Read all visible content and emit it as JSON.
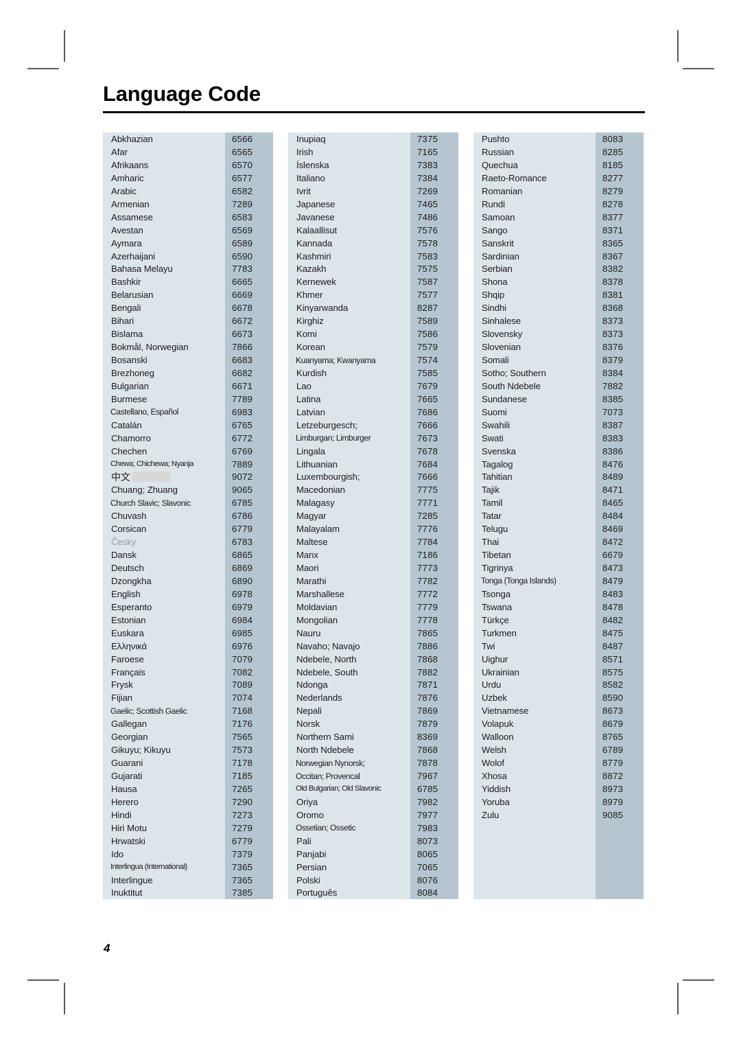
{
  "page": {
    "title": "Language Code",
    "page_number": "4"
  },
  "colors": {
    "name_cell_bg": "#dce5ea",
    "code_cell_bg": "#b5c6d0",
    "text": "#1a1a1a",
    "rule": "#000000",
    "redaction": "#d8d8d8",
    "crop_mark": "#5a5a5a"
  },
  "columns": [
    {
      "id": "column-1",
      "rows": [
        {
          "name": "Abkhazian",
          "code": "6566"
        },
        {
          "name": "Afar",
          "code": "6565"
        },
        {
          "name": "Afrikaans",
          "code": "6570"
        },
        {
          "name": "Amharic",
          "code": "6577"
        },
        {
          "name": "Arabic",
          "code": "6582"
        },
        {
          "name": "Armenian",
          "code": "7289"
        },
        {
          "name": "Assamese",
          "code": "6583"
        },
        {
          "name": "Avestan",
          "code": "6569"
        },
        {
          "name": "Aymara",
          "code": "6589"
        },
        {
          "name": "Azerhaijani",
          "code": "6590"
        },
        {
          "name": "Bahasa Melayu",
          "code": "7783"
        },
        {
          "name": "Bashkir",
          "code": "6665"
        },
        {
          "name": "Belarusian",
          "code": "6669"
        },
        {
          "name": "Bengali",
          "code": "6678"
        },
        {
          "name": "Bihari",
          "code": "6672"
        },
        {
          "name": "Bislama",
          "code": "6673"
        },
        {
          "name": "Bokmål, Norwegian",
          "code": "7866"
        },
        {
          "name": "Bosanski",
          "code": "6683"
        },
        {
          "name": "Brezhoneg",
          "code": "6682"
        },
        {
          "name": "Bulgarian",
          "code": "6671"
        },
        {
          "name": "Burmese",
          "code": "7789"
        },
        {
          "name": "Castellano, Español",
          "code": "6983",
          "style": "condensed"
        },
        {
          "name": "Catalán",
          "code": "6765"
        },
        {
          "name": "Chamorro",
          "code": "6772"
        },
        {
          "name": "Chechen",
          "code": "6769"
        },
        {
          "name": "Chewa; Chichewa; Nyanja",
          "code": "7889",
          "style": "very-condensed"
        },
        {
          "name": "中文",
          "code": "9072",
          "style": "cjk-redacted"
        },
        {
          "name": "Chuang; Zhuang",
          "code": "9065"
        },
        {
          "name": "Church Slavic; Slavonic",
          "code": "6785",
          "style": "condensed"
        },
        {
          "name": "Chuvash",
          "code": "6786"
        },
        {
          "name": "Corsican",
          "code": "6779"
        },
        {
          "name": "Česky",
          "code": "6783",
          "style": "faded"
        },
        {
          "name": "Dansk",
          "code": "6865"
        },
        {
          "name": "Deutsch",
          "code": "6869"
        },
        {
          "name": "Dzongkha",
          "code": "6890"
        },
        {
          "name": "English",
          "code": "6978"
        },
        {
          "name": "Esperanto",
          "code": "6979"
        },
        {
          "name": "Estonian",
          "code": "6984"
        },
        {
          "name": "Euskara",
          "code": "6985"
        },
        {
          "name": "Ελληνικά",
          "code": "6976"
        },
        {
          "name": "Faroese",
          "code": "7079"
        },
        {
          "name": "Français",
          "code": "7082"
        },
        {
          "name": "Frysk",
          "code": "7089"
        },
        {
          "name": "Fijian",
          "code": "7074"
        },
        {
          "name": "Gaelic; Scottish Gaelic",
          "code": "7168",
          "style": "condensed"
        },
        {
          "name": "Gallegan",
          "code": "7176"
        },
        {
          "name": "Georgian",
          "code": "7565"
        },
        {
          "name": "Gikuyu; Kikuyu",
          "code": "7573"
        },
        {
          "name": "Guarani",
          "code": "7178"
        },
        {
          "name": "Gujarati",
          "code": "7185"
        },
        {
          "name": "Hausa",
          "code": "7265"
        },
        {
          "name": "Herero",
          "code": "7290"
        },
        {
          "name": "Hindi",
          "code": "7273"
        },
        {
          "name": "Hiri Motu",
          "code": "7279"
        },
        {
          "name": "Hrwatski",
          "code": "6779"
        },
        {
          "name": "Ido",
          "code": "7379"
        },
        {
          "name": "Interlingua (International)",
          "code": "7365",
          "style": "very-condensed"
        },
        {
          "name": "Interlingue",
          "code": "7365"
        },
        {
          "name": "Inuktitut",
          "code": "7385"
        }
      ]
    },
    {
      "id": "column-2",
      "rows": [
        {
          "name": "Inupiaq",
          "code": "7375"
        },
        {
          "name": "Irish",
          "code": "7165"
        },
        {
          "name": "Íslenska",
          "code": "7383"
        },
        {
          "name": "Italiano",
          "code": "7384"
        },
        {
          "name": "Ivrit",
          "code": "7269"
        },
        {
          "name": "Japanese",
          "code": "7465"
        },
        {
          "name": "Javanese",
          "code": "7486"
        },
        {
          "name": "Kalaallisut",
          "code": "7576"
        },
        {
          "name": "Kannada",
          "code": "7578"
        },
        {
          "name": "Kashmiri",
          "code": "7583"
        },
        {
          "name": "Kazakh",
          "code": "7575"
        },
        {
          "name": "Kernewek",
          "code": "7587"
        },
        {
          "name": "Khmer",
          "code": "7577"
        },
        {
          "name": "Kinyarwanda",
          "code": "8287"
        },
        {
          "name": "Kirghiz",
          "code": "7589"
        },
        {
          "name": "Komi",
          "code": "7586"
        },
        {
          "name": "Korean",
          "code": "7579"
        },
        {
          "name": "Kuanyama; Kwanyama",
          "code": "7574",
          "style": "condensed"
        },
        {
          "name": "Kurdish",
          "code": "7585"
        },
        {
          "name": "Lao",
          "code": "7679"
        },
        {
          "name": "Latina",
          "code": "7665"
        },
        {
          "name": "Latvian",
          "code": "7686"
        },
        {
          "name": "Letzeburgesch;",
          "code": "7666"
        },
        {
          "name": "Limburgan; Limburger",
          "code": "7673",
          "style": "condensed"
        },
        {
          "name": "Lingala",
          "code": "7678"
        },
        {
          "name": "Lithuanian",
          "code": "7684"
        },
        {
          "name": "Luxembourgish;",
          "code": "7666"
        },
        {
          "name": "Macedonian",
          "code": "7775"
        },
        {
          "name": "Malagasy",
          "code": "7771"
        },
        {
          "name": "Magyar",
          "code": "7285"
        },
        {
          "name": "Malayalam",
          "code": "7776"
        },
        {
          "name": "Maltese",
          "code": "7784"
        },
        {
          "name": "Manx",
          "code": "7186"
        },
        {
          "name": "Maori",
          "code": "7773"
        },
        {
          "name": "Marathi",
          "code": "7782"
        },
        {
          "name": "Marshallese",
          "code": "7772"
        },
        {
          "name": "Moldavian",
          "code": "7779"
        },
        {
          "name": "Mongolian",
          "code": "7778"
        },
        {
          "name": "Nauru",
          "code": "7865"
        },
        {
          "name": "Navaho; Navajo",
          "code": "7886"
        },
        {
          "name": "Ndebele, North",
          "code": "7868"
        },
        {
          "name": "Ndebele, South",
          "code": "7882"
        },
        {
          "name": "Ndonga",
          "code": "7871"
        },
        {
          "name": "Nederlands",
          "code": "7876"
        },
        {
          "name": "Nepali",
          "code": "7869"
        },
        {
          "name": "Norsk",
          "code": "7879"
        },
        {
          "name": "Northern Sami",
          "code": "8369"
        },
        {
          "name": "North Ndebele",
          "code": "7868"
        },
        {
          "name": "Norwegian Nynorsk;",
          "code": "7878",
          "style": "condensed"
        },
        {
          "name": "Occitan; Provencal",
          "code": "7967",
          "style": "condensed"
        },
        {
          "name": "Old Bulgarian; Old Slavonic",
          "code": "6785",
          "style": "very-condensed"
        },
        {
          "name": "Oriya",
          "code": "7982"
        },
        {
          "name": "Oromo",
          "code": "7977"
        },
        {
          "name": "Ossetian; Ossetic",
          "code": "7983",
          "style": "condensed"
        },
        {
          "name": "Pali",
          "code": "8073"
        },
        {
          "name": "Panjabi",
          "code": "8065"
        },
        {
          "name": "Persian",
          "code": "7065"
        },
        {
          "name": "Polski",
          "code": "8076"
        },
        {
          "name": "Português",
          "code": "8084"
        }
      ]
    },
    {
      "id": "column-3",
      "rows": [
        {
          "name": "Pushto",
          "code": "8083"
        },
        {
          "name": "Russian",
          "code": "8285"
        },
        {
          "name": "Quechua",
          "code": "8185"
        },
        {
          "name": "Raeto-Romance",
          "code": "8277"
        },
        {
          "name": "Romanian",
          "code": "8279"
        },
        {
          "name": "Rundi",
          "code": "8278"
        },
        {
          "name": "Samoan",
          "code": "8377"
        },
        {
          "name": "Sango",
          "code": "8371"
        },
        {
          "name": "Sanskrit",
          "code": "8365"
        },
        {
          "name": "Sardinian",
          "code": "8367"
        },
        {
          "name": "Serbian",
          "code": "8382"
        },
        {
          "name": "Shona",
          "code": "8378"
        },
        {
          "name": "Shqip",
          "code": "8381"
        },
        {
          "name": "Sindhi",
          "code": "8368"
        },
        {
          "name": "Sinhalese",
          "code": "8373"
        },
        {
          "name": "Slovensky",
          "code": "8373"
        },
        {
          "name": "Slovenian",
          "code": "8376"
        },
        {
          "name": "Somali",
          "code": "8379"
        },
        {
          "name": "Sotho; Southern",
          "code": "8384"
        },
        {
          "name": "South Ndebele",
          "code": "7882"
        },
        {
          "name": "Sundanese",
          "code": "8385"
        },
        {
          "name": "Suomi",
          "code": "7073"
        },
        {
          "name": "Swahili",
          "code": "8387"
        },
        {
          "name": "Swati",
          "code": "8383"
        },
        {
          "name": "Svenska",
          "code": "8386"
        },
        {
          "name": "Tagalog",
          "code": "8476"
        },
        {
          "name": "Tahitian",
          "code": "8489"
        },
        {
          "name": "Tajik",
          "code": "8471"
        },
        {
          "name": "Tamil",
          "code": "8465"
        },
        {
          "name": "Tatar",
          "code": "8484"
        },
        {
          "name": "Telugu",
          "code": "8469"
        },
        {
          "name": "Thai",
          "code": "8472"
        },
        {
          "name": "Tibetan",
          "code": "6679"
        },
        {
          "name": "Tigrinya",
          "code": "8473"
        },
        {
          "name": "Tonga (Tonga Islands)",
          "code": "8479",
          "style": "condensed"
        },
        {
          "name": "Tsonga",
          "code": "8483"
        },
        {
          "name": "Tswana",
          "code": "8478"
        },
        {
          "name": "Türkçe",
          "code": "8482"
        },
        {
          "name": "Turkmen",
          "code": "8475"
        },
        {
          "name": "Twi",
          "code": "8487"
        },
        {
          "name": "Uighur",
          "code": "8571"
        },
        {
          "name": "Ukrainian",
          "code": "8575"
        },
        {
          "name": "Urdu",
          "code": "8582"
        },
        {
          "name": "Uzbek",
          "code": "8590"
        },
        {
          "name": "Vietnamese",
          "code": "8673"
        },
        {
          "name": "Volapuk",
          "code": "8679"
        },
        {
          "name": "Walloon",
          "code": "8765"
        },
        {
          "name": "Welsh",
          "code": "6789"
        },
        {
          "name": "Wolof",
          "code": "8779"
        },
        {
          "name": "Xhosa",
          "code": "8872"
        },
        {
          "name": "Yiddish",
          "code": "8973"
        },
        {
          "name": "Yoruba",
          "code": "8979"
        },
        {
          "name": "Zulu",
          "code": "9085"
        }
      ]
    }
  ]
}
